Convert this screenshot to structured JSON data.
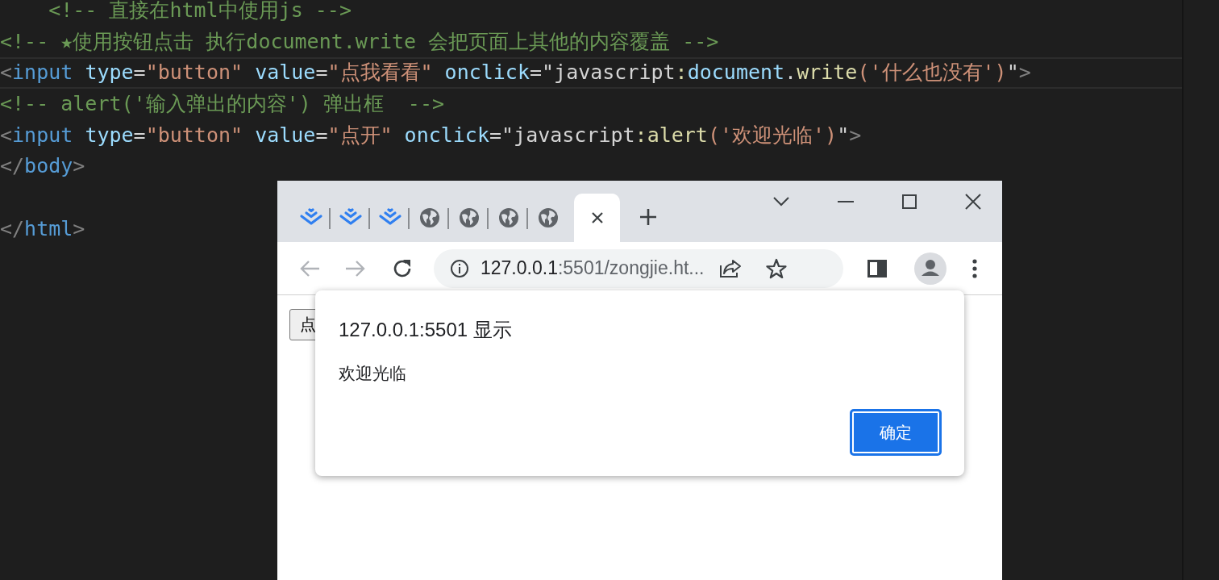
{
  "editor": {
    "lines": [
      {
        "current": false,
        "tokens": [
          {
            "kind": "comment",
            "text": "    <!-- 直接在html中使用js -->"
          }
        ]
      },
      {
        "current": false,
        "tokens": [
          {
            "kind": "comment",
            "text": "<!-- ★使用按钮点击 执行document.write 会把页面上其他的内容覆盖 -->"
          }
        ]
      },
      {
        "current": true,
        "tokens": [
          {
            "kind": "punct",
            "text": "<"
          },
          {
            "kind": "tag",
            "text": "input"
          },
          {
            "kind": "attr",
            "text": " type"
          },
          {
            "kind": "plain",
            "text": "="
          },
          {
            "kind": "string",
            "text": "\"button\""
          },
          {
            "kind": "attr",
            "text": " value"
          },
          {
            "kind": "plain",
            "text": "="
          },
          {
            "kind": "string",
            "text": "\"点我看看\""
          },
          {
            "kind": "attr",
            "text": " onclick"
          },
          {
            "kind": "plain",
            "text": "=\"javascript"
          },
          {
            "kind": "func",
            "text": ":"
          },
          {
            "kind": "attr",
            "text": "document"
          },
          {
            "kind": "plain",
            "text": "."
          },
          {
            "kind": "func",
            "text": "write"
          },
          {
            "kind": "string",
            "text": "('什么也没有')"
          },
          {
            "kind": "plain",
            "text": "\""
          },
          {
            "kind": "punct",
            "text": ">"
          }
        ]
      },
      {
        "current": false,
        "tokens": [
          {
            "kind": "comment",
            "text": "<!-- alert('输入弹出的内容') 弹出框  -->"
          }
        ]
      },
      {
        "current": false,
        "tokens": [
          {
            "kind": "punct",
            "text": "<"
          },
          {
            "kind": "tag",
            "text": "input"
          },
          {
            "kind": "attr",
            "text": " type"
          },
          {
            "kind": "plain",
            "text": "="
          },
          {
            "kind": "string",
            "text": "\"button\""
          },
          {
            "kind": "attr",
            "text": " value"
          },
          {
            "kind": "plain",
            "text": "="
          },
          {
            "kind": "string",
            "text": "\"点开\""
          },
          {
            "kind": "attr",
            "text": " onclick"
          },
          {
            "kind": "plain",
            "text": "=\"javascript"
          },
          {
            "kind": "func",
            "text": ":alert"
          },
          {
            "kind": "string",
            "text": "('欢迎光临')"
          },
          {
            "kind": "plain",
            "text": "\""
          },
          {
            "kind": "punct",
            "text": ">"
          }
        ]
      },
      {
        "current": false,
        "tokens": [
          {
            "kind": "punct",
            "text": "</"
          },
          {
            "kind": "tag",
            "text": "body"
          },
          {
            "kind": "punct",
            "text": ">"
          }
        ]
      },
      {
        "kind": "blank"
      },
      {
        "current": false,
        "tokens": [
          {
            "kind": "punct",
            "text": "</"
          },
          {
            "kind": "tag",
            "text": "html"
          },
          {
            "kind": "punct",
            "text": ">"
          }
        ]
      }
    ]
  },
  "browser": {
    "tabs": [
      {
        "kind": "stack",
        "selected": false
      },
      {
        "kind": "stack",
        "selected": false
      },
      {
        "kind": "stack",
        "selected": false
      },
      {
        "kind": "globe",
        "selected": false
      },
      {
        "kind": "globe",
        "selected": false
      },
      {
        "kind": "globe",
        "selected": false
      },
      {
        "kind": "globe",
        "selected": false
      },
      {
        "kind": "blank",
        "selected": true
      }
    ],
    "back": {
      "disabled": true
    },
    "forward": {
      "disabled": true
    },
    "address": {
      "host": "127.0.0.1",
      "path": ":5501/zongjie.ht..."
    },
    "page_button": "点",
    "dialog": {
      "title": "127.0.0.1:5501 显示",
      "message": "欢迎光临",
      "button": "确定"
    }
  }
}
